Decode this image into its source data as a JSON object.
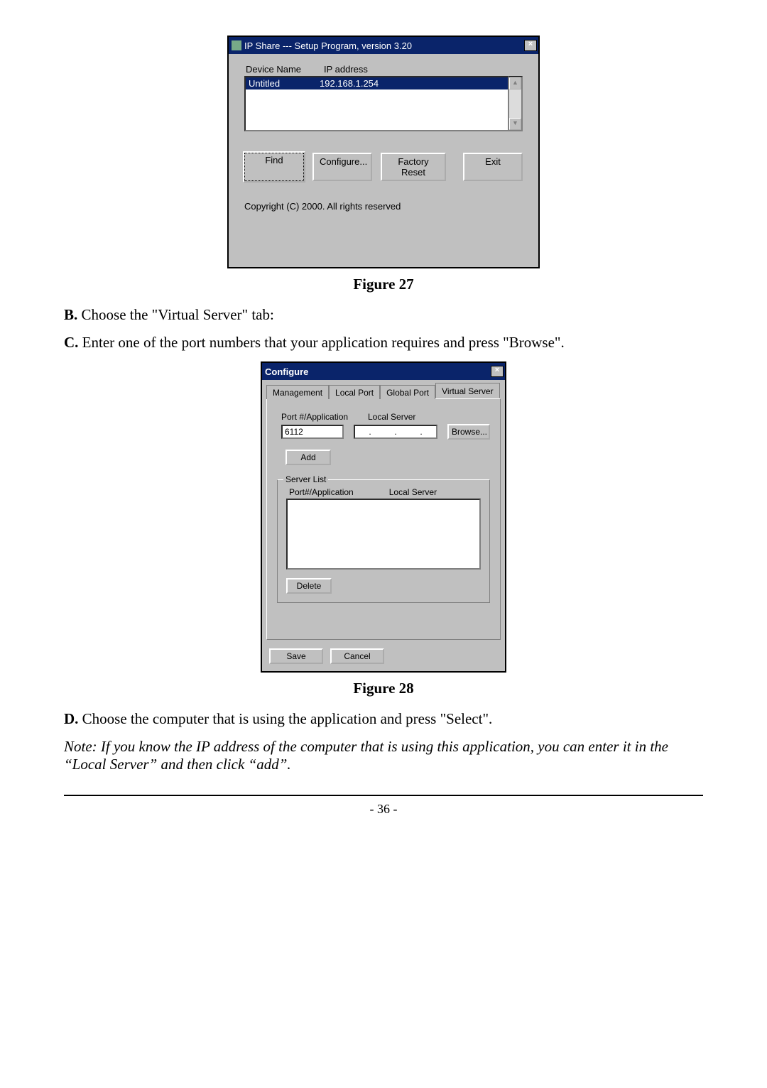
{
  "fig27": {
    "window_title": "IP Share --- Setup Program, version 3.20",
    "close_glyph": "×",
    "headers": {
      "device": "Device Name",
      "ip": "IP address"
    },
    "row": {
      "device": "Untitled",
      "ip": "192.168.1.254"
    },
    "scroll_up": "▲",
    "scroll_down": "▼",
    "buttons": {
      "find": "Find",
      "configure": "Configure...",
      "factory": "Factory Reset",
      "exit": "Exit"
    },
    "copyright": "Copyright (C) 2000.  All rights reserved"
  },
  "caption27": "Figure 27",
  "paraB": {
    "letter": "B.",
    "text": " Choose the \"Virtual Server\" tab:"
  },
  "paraC": {
    "letter": "C.",
    "text": " Enter one of the port numbers that your application requires and press \"Browse\"."
  },
  "fig28": {
    "window_title": "Configure",
    "close_glyph": "×",
    "tabs": {
      "t1": "Management",
      "t2": "Local Port",
      "t3": "Global Port",
      "t4": "Virtual Server"
    },
    "labels": {
      "port": "Port #/Application",
      "local": "Local Server"
    },
    "port_value": "6112",
    "ip_dots": ". . .",
    "browse": "Browse...",
    "add": "Add",
    "group_legend": "Server List",
    "sl_headers": {
      "port": "Port#/Application",
      "local": "Local Server"
    },
    "delete": "Delete",
    "save": "Save",
    "cancel": "Cancel"
  },
  "caption28": "Figure 28",
  "paraD": {
    "letter": "D.",
    "text": " Choose the computer that is using the application and press \"Select\"."
  },
  "note": "Note: If you know the IP address of the computer that is using this application, you can enter it in the “Local Server” and then click “add”.",
  "pagenum": "- 36 -"
}
